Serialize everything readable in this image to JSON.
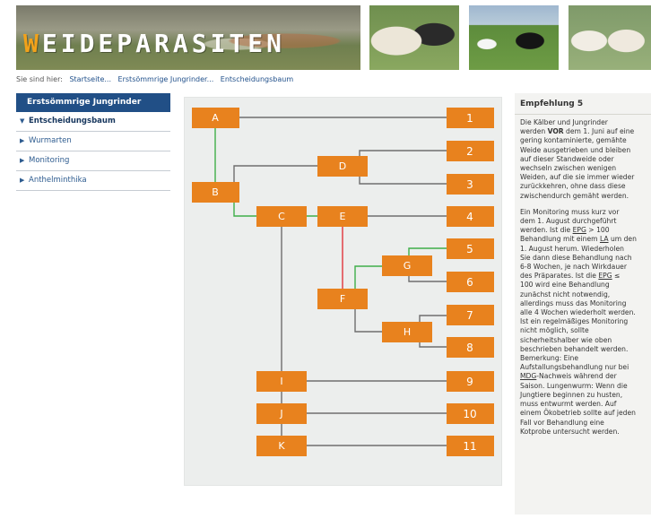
{
  "header": {
    "title_first": "W",
    "title_rest": "EIDEPARASITEN"
  },
  "breadcrumb": {
    "prefix": "Sie sind hier:",
    "items": [
      "Startseite...",
      "Erstsömmrige Jungrinder...",
      "Entscheidungsbaum"
    ]
  },
  "sidebar": {
    "header": "Erstsömmrige Jungrinder",
    "items": [
      {
        "label": "Entscheidungsbaum",
        "active": true
      },
      {
        "label": "Wurmarten",
        "active": false
      },
      {
        "label": "Monitoring",
        "active": false
      },
      {
        "label": "Anthelminthika",
        "active": false
      }
    ]
  },
  "diagram": {
    "colors": {
      "node": "#e8821e",
      "node_text": "#ffffff",
      "line_gray": "#6e6e6e",
      "line_green": "#3fae49",
      "line_red": "#e0343c"
    },
    "nodes": [
      "A",
      "B",
      "C",
      "D",
      "E",
      "F",
      "G",
      "H",
      "I",
      "J",
      "K",
      "1",
      "2",
      "3",
      "4",
      "5",
      "6",
      "7",
      "8",
      "9",
      "10",
      "11"
    ]
  },
  "recommendation": {
    "title": "Empfehlung 5",
    "para1": [
      "Die Kälber und Jungrinder",
      [
        "werden ",
        "VOR",
        " dem 1. Juni auf eine"
      ],
      "gering kontaminierte, gemähte",
      "Weide ausgetrieben und bleiben",
      "auf dieser Standweide oder",
      "wechseln zwischen wenigen",
      "Weiden, auf die sie immer wieder",
      "zurückkehren, ohne dass diese",
      "zwischendurch gemäht werden."
    ],
    "para2": [
      "Ein Monitoring muss kurz vor",
      "dem 1. August durchgeführt",
      [
        "werden. Ist die ",
        "EPG",
        " > 100"
      ],
      [
        "Behandlung mit einem ",
        "LA",
        " um den"
      ],
      "1. August herum. Wiederholen",
      "Sie dann diese Behandlung nach",
      "6-8 Wochen, je nach Wirkdauer",
      [
        "des Präparates. Ist die ",
        "EPG",
        " ≤"
      ],
      "100 wird eine Behandlung",
      "zunächst nicht notwendig,",
      "allerdings muss das Monitoring",
      "alle 4 Wochen wiederholt werden.",
      "Ist ein regelmäßiges Monitoring",
      "nicht möglich, sollte",
      "sicherheitshalber wie oben",
      "beschrieben behandelt werden.",
      "Bemerkung: Eine",
      "Aufstallungsbehandlung nur bei",
      [
        "",
        "MDG",
        "-Nachweis während der"
      ],
      "Saison. Lungenwurm: Wenn die",
      "Jungtiere beginnen zu husten,",
      "muss entwurmt werden. Auf",
      "einem Ökobetrieb sollte auf jeden",
      "Fall vor Behandlung eine",
      "Kotprobe untersucht werden."
    ]
  }
}
